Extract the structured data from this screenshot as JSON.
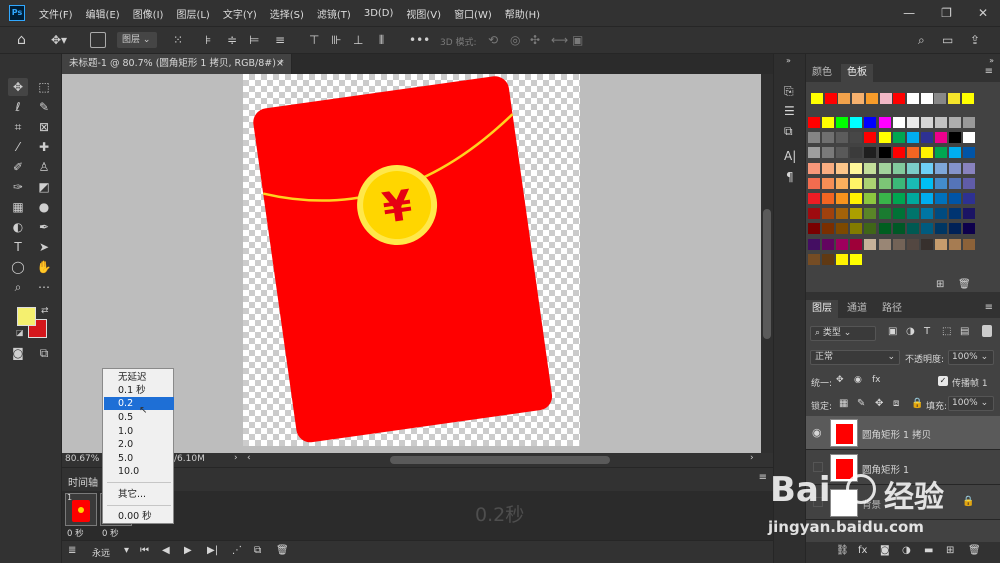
{
  "app": {
    "logo": "Ps"
  },
  "menu": [
    "文件(F)",
    "编辑(E)",
    "图像(I)",
    "图层(L)",
    "文字(Y)",
    "选择(S)",
    "滤镜(T)",
    "3D(D)",
    "视图(V)",
    "窗口(W)",
    "帮助(H)"
  ],
  "options_bar": {
    "auto_select_target": "图层",
    "mode_3d_label": "3D 模式:"
  },
  "document": {
    "tab_title": "未标题-1 @ 80.7% (圆角矩形 1 拷贝, RGB/8#) *",
    "tab_close": "×"
  },
  "canvas": {
    "glyph": "¥",
    "colors": {
      "envelope": "#ff0000",
      "coin": "#ffd600",
      "coin_ring": "#ffe84a",
      "string": "#ffd21f",
      "background": "#bdbdbd"
    }
  },
  "status": {
    "zoom": "80.67%",
    "doc_info": "/6.10M"
  },
  "timeline": {
    "title": "时间轴",
    "frame_label": "1",
    "frame_delay": "0 秒",
    "second_delay": "0 秒",
    "current_delay_display": "0.2秒",
    "loop_option": "永远"
  },
  "delay_menu": {
    "items": [
      "无延迟",
      "0.1 秒",
      "0.2",
      "0.5",
      "1.0",
      "2.0",
      "5.0",
      "10.0"
    ],
    "selected_index": 2,
    "other": "其它...",
    "current": "0.00 秒"
  },
  "color_panel": {
    "tabs": [
      "颜色",
      "色板"
    ],
    "active_tab": "色板",
    "recent_swatches": [
      "#ffff00",
      "#ff0000",
      "#f2a24b",
      "#f6b16e",
      "#f79c2a",
      "#f2b8c6",
      "#ff0000",
      "#ffffff",
      "#ffffff",
      "#888888",
      "#f5e42a",
      "#ffff00"
    ],
    "swatch_grid": [
      [
        "#ff0000",
        "#ffff00",
        "#00ff00",
        "#00ffff",
        "#0000ff",
        "#ff00ff",
        "#ffffff",
        "#ebebeb",
        "#d6d6d6",
        "#c2c2c2",
        "#adadad",
        "#999999"
      ],
      [
        "#858585",
        "#707070",
        "#5c5c5c",
        "#474747",
        "#ff0000",
        "#ffff00",
        "#00a651",
        "#00aeef",
        "#2e3192",
        "#ec008c",
        "#000000",
        "#ffffff"
      ],
      [
        "#9e9e9e",
        "#7a7a7a",
        "#595959",
        "#3b3b3b",
        "#1f1f1f",
        "#000000",
        "#ff0000",
        "#f26522",
        "#fff200",
        "#00a651",
        "#00aeef",
        "#0054a6"
      ],
      [
        "#f7977a",
        "#f9ad81",
        "#fdc68a",
        "#fff79a",
        "#c4df9b",
        "#a2d39c",
        "#82ca9d",
        "#7bcdc8",
        "#6ecff6",
        "#7ea7d8",
        "#8493ca",
        "#8882be"
      ],
      [
        "#f26c4f",
        "#f68e55",
        "#fbaf5d",
        "#fff467",
        "#acd372",
        "#7cc576",
        "#3bb878",
        "#1abbb4",
        "#00bff3",
        "#438ccb",
        "#5574b9",
        "#605ca8"
      ],
      [
        "#ed1c24",
        "#f26522",
        "#f7941d",
        "#fff200",
        "#8dc73f",
        "#39b54a",
        "#00a651",
        "#00a99d",
        "#00aeef",
        "#0072bc",
        "#0054a6",
        "#2e3192"
      ],
      [
        "#9e0b0f",
        "#a0410d",
        "#a36209",
        "#aba000",
        "#598527",
        "#1a7b30",
        "#007236",
        "#00746b",
        "#0076a3",
        "#004b80",
        "#003471",
        "#1b1464"
      ],
      [
        "#790000",
        "#7b2e00",
        "#7d4900",
        "#827b00",
        "#406618",
        "#005e20",
        "#005826",
        "#005952",
        "#005b7f",
        "#003663",
        "#002157",
        "#0d004c"
      ],
      [
        "#440e62",
        "#630460",
        "#9e005d",
        "#9e0039",
        "#c7b299",
        "#998675",
        "#736357",
        "#534741",
        "#37302d",
        "#c69c6d",
        "#a67c52",
        "#8c6239"
      ],
      [
        "#754c24",
        "#603913",
        "#fff200",
        "#ffff00"
      ]
    ]
  },
  "layers_panel": {
    "tabs": [
      "图层",
      "通道",
      "路径"
    ],
    "active_tab": "图层",
    "filter_kind": "类型",
    "blend_mode": "正常",
    "opacity_label": "不透明度:",
    "opacity_value": "100%",
    "unify_label": "统一:",
    "propagate_label": "传播帧 1",
    "lock_label": "锁定:",
    "fill_label": "填充:",
    "fill_value": "100%",
    "layers": [
      {
        "name": "圆角矩形 1 拷贝",
        "visible": true,
        "selected": true
      },
      {
        "name": "圆角矩形 1",
        "visible": false,
        "selected": false
      },
      {
        "name": "背景",
        "visible": false,
        "selected": false
      }
    ]
  },
  "watermark": {
    "brand_left": "Bai",
    "brand_right": "经验",
    "url": "jingyan.baidu.com"
  }
}
